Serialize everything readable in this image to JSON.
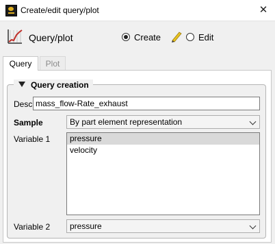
{
  "window": {
    "title": "Create/edit query/plot",
    "close_glyph": "✕"
  },
  "header": {
    "label": "Query/plot",
    "mode": {
      "create_label": "Create",
      "edit_label": "Edit",
      "selected": "create"
    }
  },
  "tabs": [
    {
      "label": "Query",
      "active": true
    },
    {
      "label": "Plot",
      "active": false
    }
  ],
  "group": {
    "title": "Query creation",
    "desc": {
      "label": "Desc",
      "value": "mass_flow-Rate_exhaust"
    },
    "sample": {
      "label": "Sample",
      "value": "By part element representation"
    },
    "variable1": {
      "label": "Variable 1",
      "items": [
        "pressure",
        "velocity"
      ],
      "selected_index": 0
    },
    "variable2": {
      "label": "Variable 2",
      "value": "pressure"
    }
  },
  "icons": [
    "app-icon",
    "chart-icon",
    "pencil-icon",
    "collapse-triangle-icon",
    "chevron-down-icon",
    "close-icon"
  ],
  "colors": {
    "accent_red": "#c0302a",
    "pencil_yellow": "#e8c320",
    "selection": "#d9d9d9"
  }
}
